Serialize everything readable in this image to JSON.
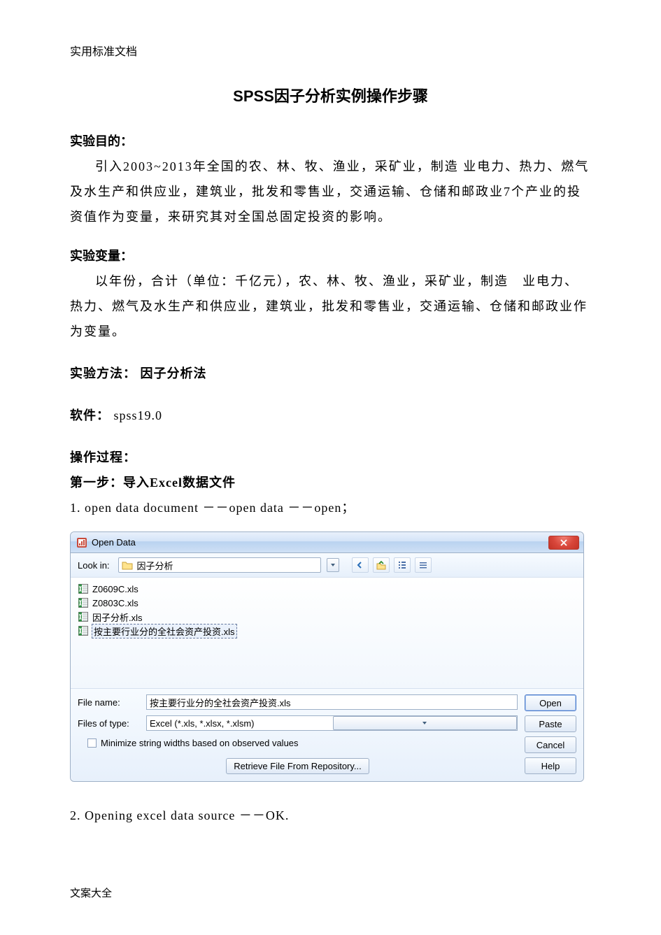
{
  "header_note": "实用标准文档",
  "footer_note": "文案大全",
  "title": "SPSS因子分析实例操作步骤",
  "sections": {
    "purpose_label": "实验目的：",
    "purpose_text": "引入2003~2013年全国的农、林、牧、渔业，采矿业，制造 业电力、热力、燃气及水生产和供应业，建筑业，批发和零售业，交通运输、仓储和邮政业7个产业的投资值作为变量，来研究其对全国总固定投资的影响。",
    "vars_label": "实验变量：",
    "vars_text": "以年份，合计（单位：千亿元），农、林、牧、渔业，采矿业，制造　业电力、热力、燃气及水生产和供应业，建筑业，批发和零售业，交通运输、仓储和邮政业作为变量。",
    "method_label": "实验方法：",
    "method_value": "因子分析法",
    "software_label": "软件：",
    "software_value": "spss19.0",
    "process_label": "操作过程：",
    "step1_label": "第一步：导入Excel数据文件",
    "step1_text": "1. open data document －－open data －－open；",
    "step2_text": "2. Opening excel data source －－OK."
  },
  "dialog": {
    "title": "Open Data",
    "look_in_label": "Look in:",
    "look_in_value": "因子分析",
    "files": [
      {
        "name": "Z0609C.xls",
        "selected": false
      },
      {
        "name": "Z0803C.xls",
        "selected": false
      },
      {
        "name": "因子分析.xls",
        "selected": false
      },
      {
        "name": "按主要行业分的全社会资产投资.xls",
        "selected": true
      }
    ],
    "file_name_label": "File name:",
    "file_name_value": "按主要行业分的全社会资产投资.xls",
    "file_type_label": "Files of type:",
    "file_type_value": "Excel (*.xls, *.xlsx, *.xlsm)",
    "minimize_label": "Minimize string widths based on observed values",
    "retrieve_label": "Retrieve File From Repository...",
    "buttons": {
      "open": "Open",
      "paste": "Paste",
      "cancel": "Cancel",
      "help": "Help"
    }
  }
}
